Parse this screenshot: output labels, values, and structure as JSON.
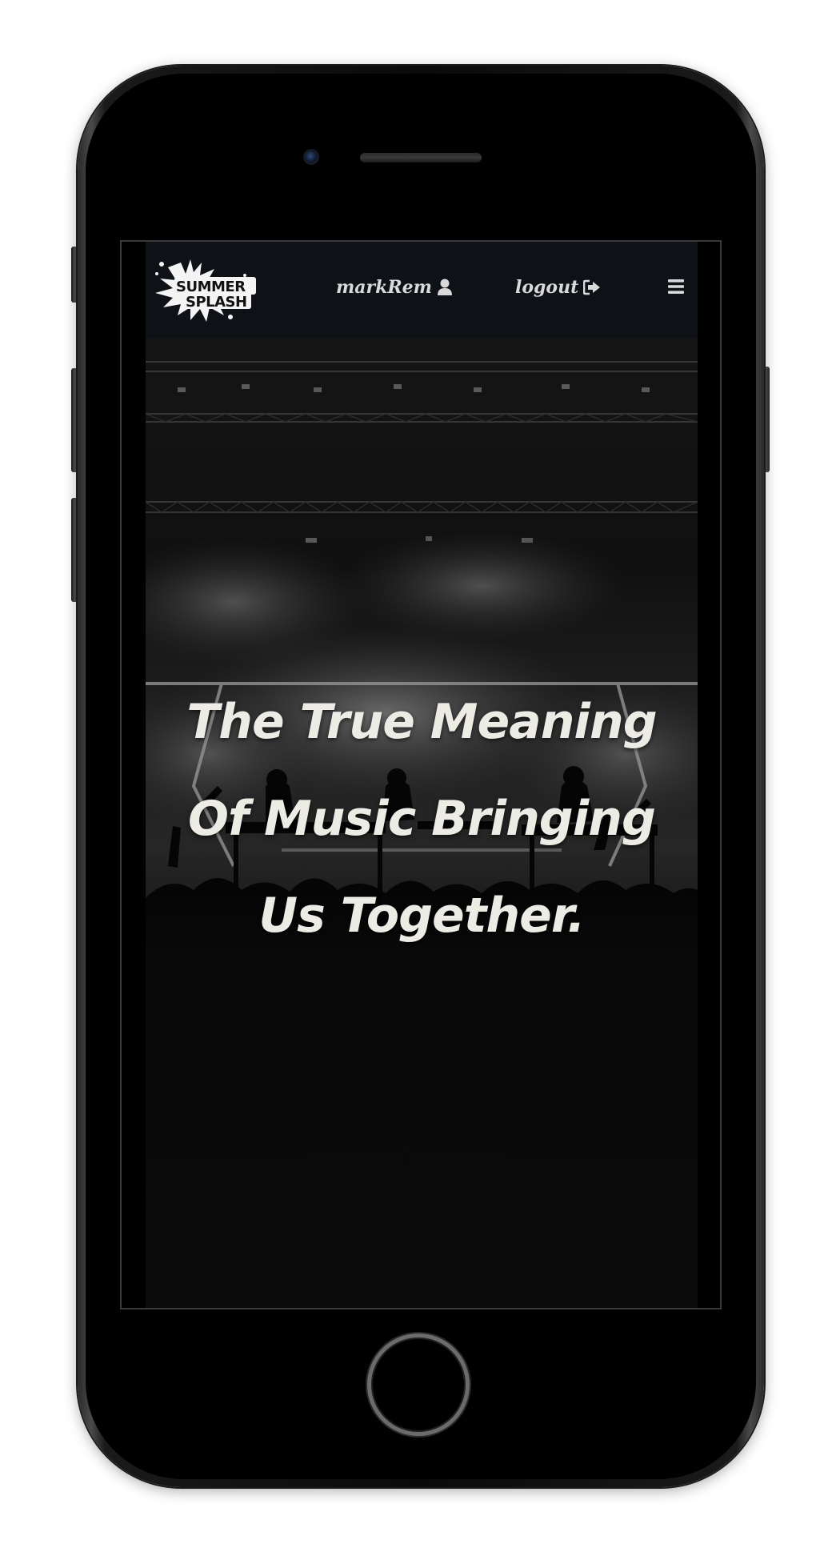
{
  "navbar": {
    "logo_line1": "SUMMER",
    "logo_line2": "SPLASH",
    "user_label": "markRem",
    "user_icon": "user-icon",
    "logout_label": "logout",
    "logout_icon": "sign-out-icon",
    "menu_icon": "hamburger-menu-icon"
  },
  "hero": {
    "headline": "The True Meaning Of Music Bringing Us Together."
  },
  "colors": {
    "navbar_bg": "#0e1217",
    "nav_text": "#d9d9d9",
    "headline_text": "#ecebe4",
    "page_bg": "#0b0b0b"
  }
}
